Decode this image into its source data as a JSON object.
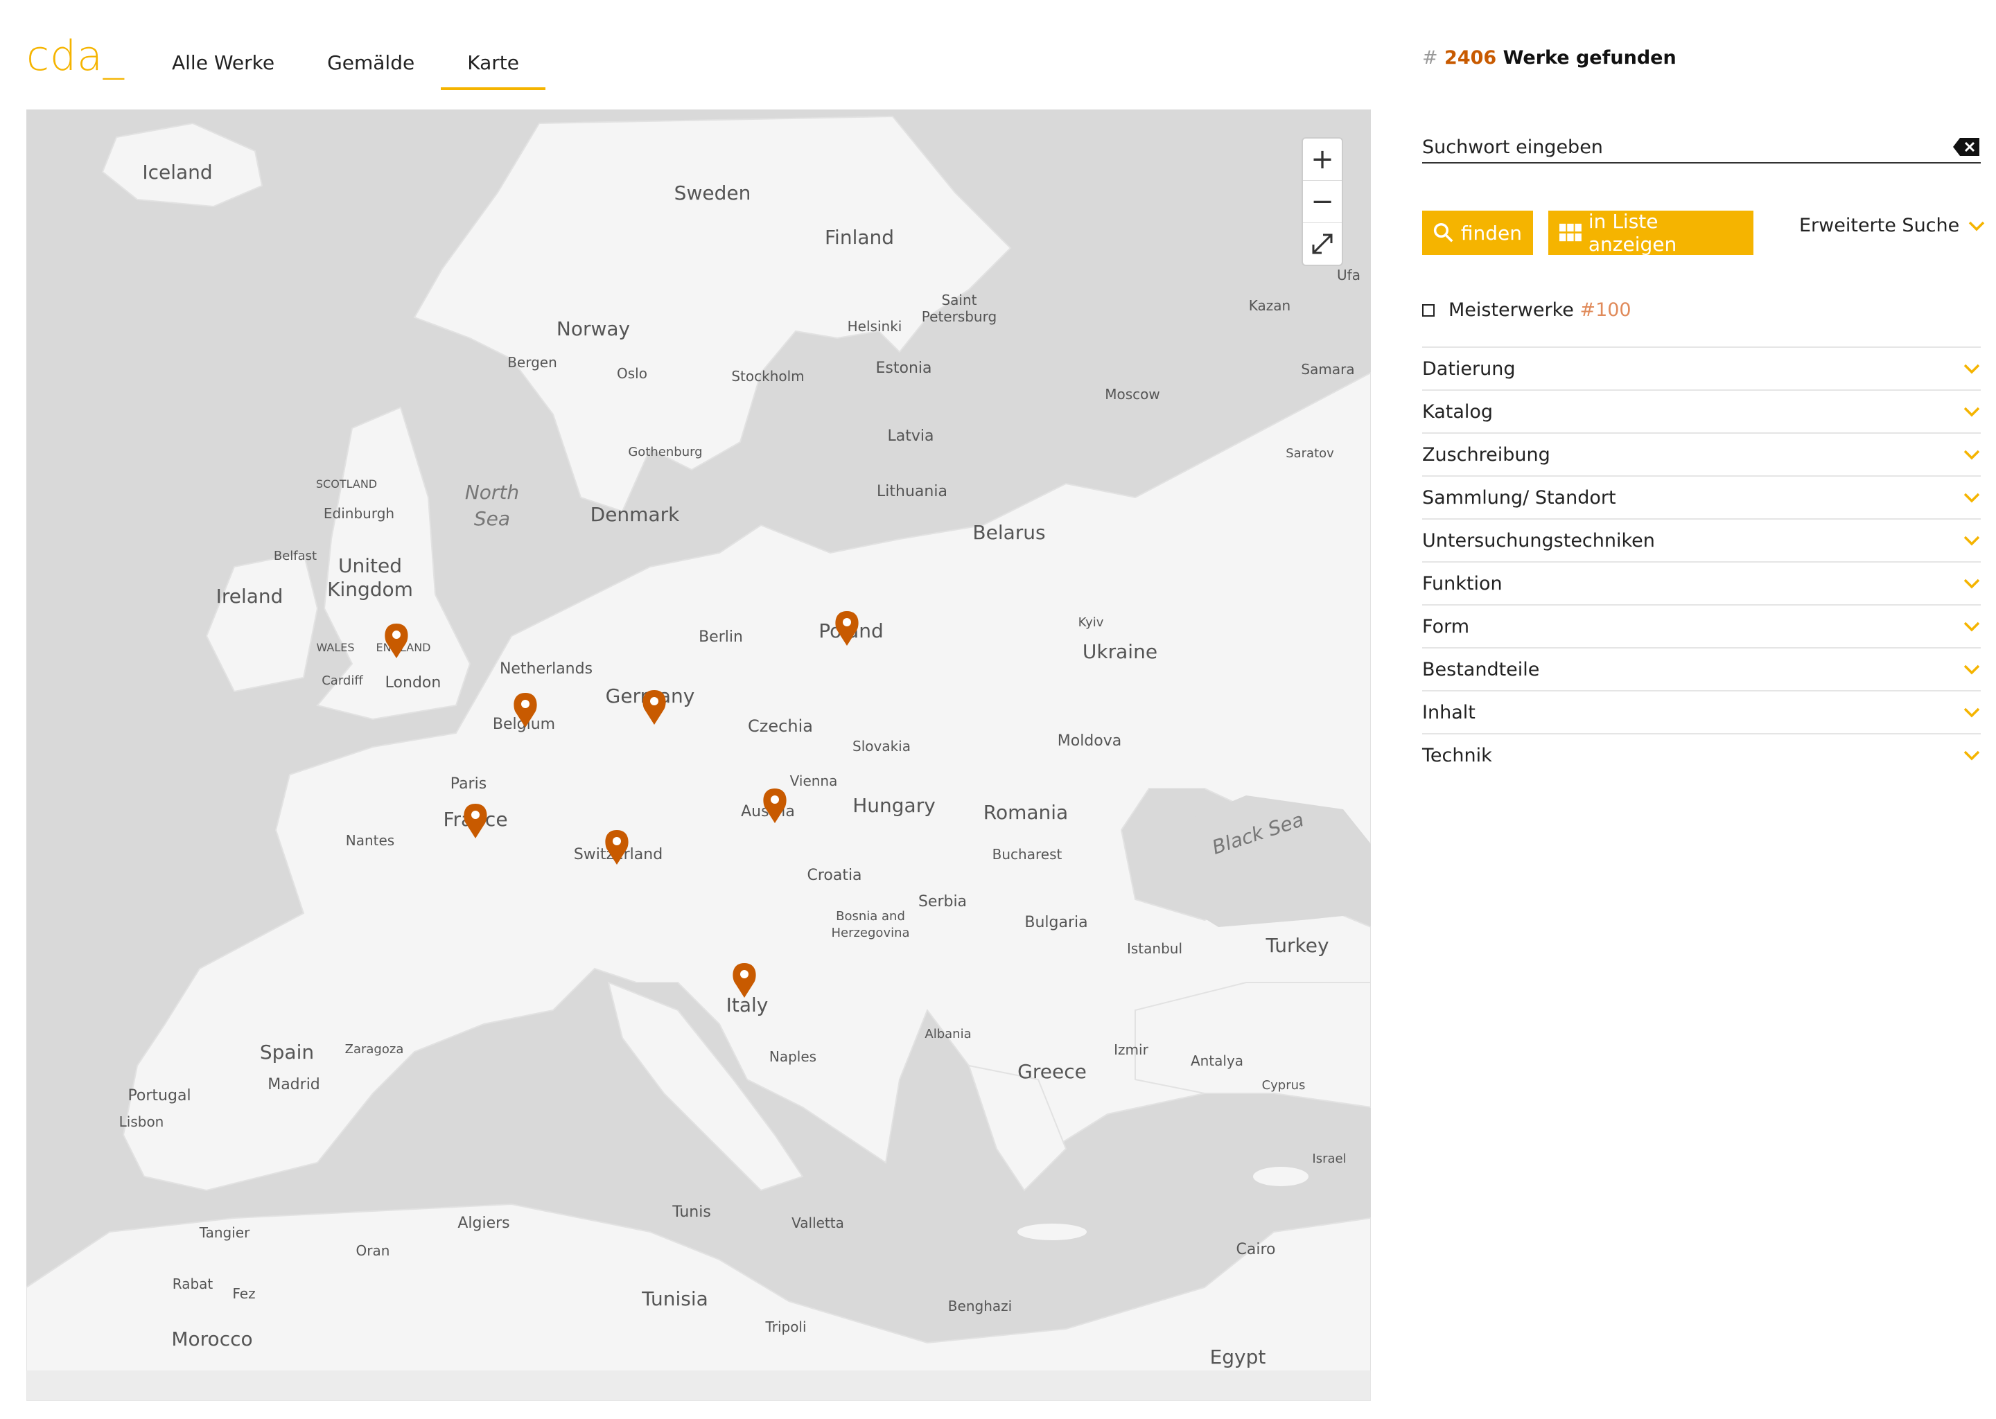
{
  "header": {
    "logo": "cda_",
    "tabs": [
      {
        "label": "Alle Werke"
      },
      {
        "label": "Gemälde"
      },
      {
        "label": "Karte"
      }
    ],
    "active_tab": "Karte"
  },
  "results": {
    "hash": "#",
    "count": "2406",
    "label": "Werke gefunden"
  },
  "search": {
    "placeholder": "Suchwort eingeben"
  },
  "buttons": {
    "find": "finden",
    "list": "in Liste anzeigen",
    "advanced": "Erweiterte Suche"
  },
  "masters": {
    "label": "Meisterwerke",
    "count": "#100"
  },
  "filters": [
    {
      "label": "Datierung"
    },
    {
      "label": "Katalog"
    },
    {
      "label": "Zuschreibung"
    },
    {
      "label": "Sammlung/ Standort"
    },
    {
      "label": "Untersuchungstechniken"
    },
    {
      "label": "Funktion"
    },
    {
      "label": "Form"
    },
    {
      "label": "Bestandteile"
    },
    {
      "label": "Inhalt"
    },
    {
      "label": "Technik"
    }
  ],
  "map": {
    "zoom_in": "+",
    "zoom_out": "−",
    "labels": {
      "iceland": "Iceland",
      "sweden": "Sweden",
      "finland": "Finland",
      "norway": "Norway",
      "helsinki": "Helsinki",
      "saint": "Saint",
      "petersburg": "Petersburg",
      "estonia": "Estonia",
      "bergen": "Bergen",
      "oslo": "Oslo",
      "stockholm": "Stockholm",
      "latvia": "Latvia",
      "gothenburg": "Gothenburg",
      "moscow": "Moscow",
      "kazan": "Kazan",
      "ufa": "Ufa",
      "samara": "Samara",
      "saratov": "Saratov",
      "lithuania": "Lithuania",
      "scotland": "SCOTLAND",
      "edinburgh": "Edinburgh",
      "north": "North",
      "sea": "Sea",
      "denmark": "Denmark",
      "belarus": "Belarus",
      "belfast": "Belfast",
      "united": "United",
      "kingdom": "Kingdom",
      "ireland": "Ireland",
      "berlin": "Berlin",
      "poland": "Poland",
      "kyiv": "Kyiv",
      "ukraine": "Ukraine",
      "wales": "WALES",
      "england": "ENGLAND",
      "netherlands": "Netherlands",
      "cardiff": "Cardiff",
      "london": "London",
      "germany": "Germany",
      "belgium": "Belgium",
      "czechia": "Czechia",
      "slovakia": "Slovakia",
      "moldova": "Moldova",
      "paris": "Paris",
      "vienna": "Vienna",
      "austria": "Austria",
      "hungary": "Hungary",
      "romania": "Romania",
      "nantes": "Nantes",
      "france": "France",
      "switzerland": "Switzerland",
      "bucharest": "Bucharest",
      "blacksea": "Black Sea",
      "croatia": "Croatia",
      "serbia": "Serbia",
      "bosnia": "Bosnia and",
      "herzegovina": "Herzegovina",
      "bulgaria": "Bulgaria",
      "istanbul": "Istanbul",
      "turkey": "Turkey",
      "italy": "Italy",
      "spain": "Spain",
      "zaragoza": "Zaragoza",
      "madrid": "Madrid",
      "portugal": "Portugal",
      "lisbon": "Lisbon",
      "albania": "Albania",
      "naples": "Naples",
      "izmir": "Izmir",
      "antalya": "Antalya",
      "greece": "Greece",
      "cyprus": "Cyprus",
      "israel": "Israel",
      "algiers": "Algiers",
      "tunis": "Tunis",
      "valletta": "Valletta",
      "tangier": "Tangier",
      "oran": "Oran",
      "cairo": "Cairo",
      "rabat": "Rabat",
      "fez": "Fez",
      "tunisia": "Tunisia",
      "tripoli": "Tripoli",
      "benghazi": "Benghazi",
      "morocco": "Morocco",
      "egypt": "Egypt"
    }
  },
  "colors": {
    "accent": "#f5b400",
    "count": "#c85a00",
    "marker": "#c85a00",
    "land": "#f5f5f5",
    "water": "#d9d9d9"
  },
  "icons": {
    "search": "search-icon",
    "grid": "grid-icon",
    "clear": "clear-icon",
    "chevron": "chevron-down-icon",
    "expand": "expand-icon",
    "marker": "map-marker-icon"
  }
}
